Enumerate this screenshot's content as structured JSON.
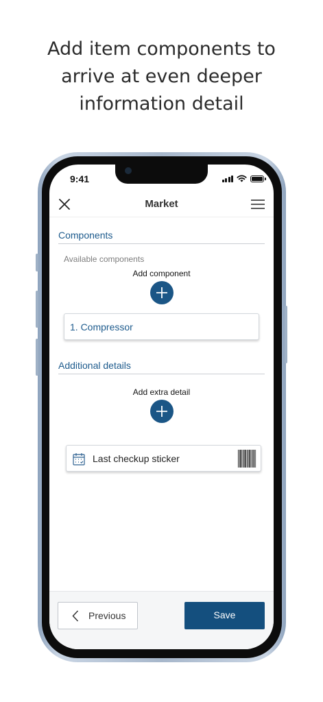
{
  "headline": {
    "line1": "Add item components to",
    "line2": "arrive at even deeper",
    "line3": "information detail"
  },
  "status_bar": {
    "time": "9:41"
  },
  "nav": {
    "title": "Market",
    "close_icon": "close-icon",
    "menu_icon": "hamburger-menu-icon"
  },
  "components": {
    "title": "Components",
    "available_label": "Available components",
    "add_label": "Add component",
    "items": [
      "1. Compressor"
    ]
  },
  "additional_details": {
    "title": "Additional details",
    "add_label": "Add extra detail",
    "items": [
      {
        "label": "Last checkup sticker",
        "icon": "calendar-icon",
        "thumbnail": "barcode-thumbnail"
      }
    ]
  },
  "footer": {
    "previous_label": "Previous",
    "save_label": "Save"
  },
  "colors": {
    "accent": "#1b5686",
    "section_title": "#1c5a8c",
    "save_button": "#144f7e",
    "phone_frame": "#a7b7cb"
  }
}
